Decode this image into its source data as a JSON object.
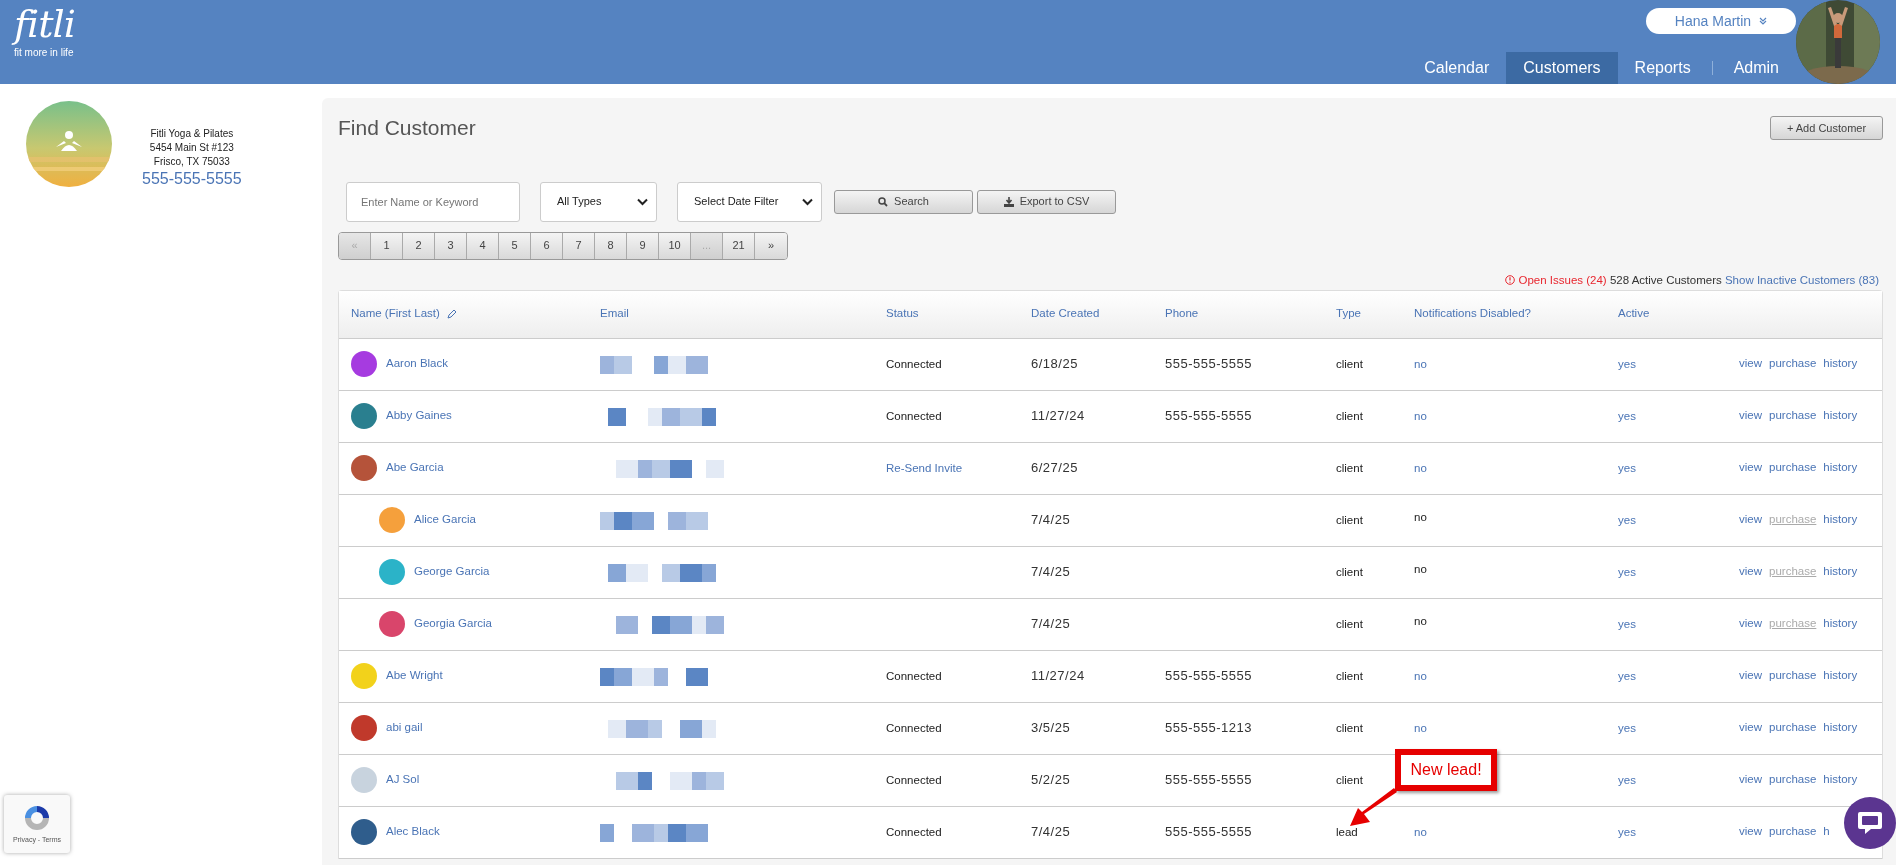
{
  "header": {
    "logo": "fitli",
    "tagline": "fit more in life",
    "user": {
      "name": "Hana Martin"
    },
    "nav": [
      {
        "label": "Calendar",
        "selected": false
      },
      {
        "label": "Customers",
        "selected": true
      },
      {
        "label": "Reports",
        "selected": false
      },
      {
        "label": "Admin",
        "selected": false
      }
    ]
  },
  "business": {
    "name": "Fitli Yoga & Pilates",
    "address": "5454 Main St #123",
    "city": "Frisco, TX 75033",
    "phone": "555-555-5555"
  },
  "page": {
    "title": "Find Customer",
    "add_button": "+ Add Customer"
  },
  "filters": {
    "search": {
      "placeholder": "Enter Name or Keyword"
    },
    "type_select": "All Types",
    "date_select": "Select Date Filter",
    "search_button": "Search",
    "export_button": "Export to CSV"
  },
  "pagination": [
    {
      "label": "«",
      "disabled": true
    },
    {
      "label": "1",
      "disabled": false
    },
    {
      "label": "2",
      "disabled": false
    },
    {
      "label": "3",
      "disabled": false
    },
    {
      "label": "4",
      "disabled": false
    },
    {
      "label": "5",
      "disabled": false
    },
    {
      "label": "6",
      "disabled": false
    },
    {
      "label": "7",
      "disabled": false
    },
    {
      "label": "8",
      "disabled": false
    },
    {
      "label": "9",
      "disabled": false
    },
    {
      "label": "10",
      "disabled": false
    },
    {
      "label": "...",
      "disabled": true
    },
    {
      "label": "21",
      "disabled": false
    },
    {
      "label": "»",
      "disabled": false
    }
  ],
  "summary": {
    "open_issues": "Open Issues (24)",
    "active": "528 Active Customers",
    "inactive_link": "Show Inactive Customers (83)"
  },
  "table": {
    "columns": [
      "Name (First Last)",
      "Email",
      "Status",
      "Date Created",
      "Phone",
      "Type",
      "Notifications Disabled?",
      "Active"
    ],
    "rows": [
      {
        "name": "Aaron Black",
        "color": "#a63be0",
        "status": "Connected",
        "status_link": false,
        "date": "6/18/25",
        "phone": "555-555-5555",
        "type": "client",
        "notifications": "no",
        "notifications_link": true,
        "active": "yes",
        "actions": [
          {
            "label": "view",
            "disabled": false
          },
          {
            "label": "purchase",
            "disabled": false
          },
          {
            "label": "history",
            "disabled": false
          }
        ]
      },
      {
        "name": "Abby Gaines",
        "color": "#2a7f8f",
        "status": "Connected",
        "status_link": false,
        "date": "11/27/24",
        "phone": "555-555-5555",
        "type": "client",
        "notifications": "no",
        "notifications_link": true,
        "active": "yes",
        "actions": [
          {
            "label": "view",
            "disabled": false
          },
          {
            "label": "purchase",
            "disabled": false
          },
          {
            "label": "history",
            "disabled": false
          }
        ]
      },
      {
        "name": "Abe Garcia",
        "color": "#b5533a",
        "status": "Re-Send Invite",
        "status_link": true,
        "date": "6/27/25",
        "type": "client",
        "notifications": "no",
        "notifications_link": true,
        "active": "yes",
        "actions": [
          {
            "label": "view",
            "disabled": false
          },
          {
            "label": "purchase",
            "disabled": false
          },
          {
            "label": "history",
            "disabled": false
          }
        ],
        "children": [
          {
            "name": "Alice Garcia",
            "color": "#f5a03c",
            "date": "7/4/25",
            "type": "client",
            "notifications": "no",
            "notifications_link": false,
            "active": "yes",
            "actions": [
              {
                "label": "view",
                "disabled": false
              },
              {
                "label": "purchase",
                "disabled": true
              },
              {
                "label": "history",
                "disabled": false
              }
            ]
          },
          {
            "name": "George Garcia",
            "color": "#2bb3c8",
            "date": "7/4/25",
            "type": "client",
            "notifications": "no",
            "notifications_link": false,
            "active": "yes",
            "actions": [
              {
                "label": "view",
                "disabled": false
              },
              {
                "label": "purchase",
                "disabled": true
              },
              {
                "label": "history",
                "disabled": false
              }
            ]
          },
          {
            "name": "Georgia Garcia",
            "color": "#d9456b",
            "date": "7/4/25",
            "type": "client",
            "notifications": "no",
            "notifications_link": false,
            "active": "yes",
            "actions": [
              {
                "label": "view",
                "disabled": false
              },
              {
                "label": "purchase",
                "disabled": true
              },
              {
                "label": "history",
                "disabled": false
              }
            ]
          }
        ]
      },
      {
        "name": "Abe Wright",
        "color": "#f2d21b",
        "status": "Connected",
        "status_link": false,
        "date": "11/27/24",
        "phone": "555-555-5555",
        "type": "client",
        "notifications": "no",
        "notifications_link": true,
        "active": "yes",
        "actions": [
          {
            "label": "view",
            "disabled": false
          },
          {
            "label": "purchase",
            "disabled": false
          },
          {
            "label": "history",
            "disabled": false
          }
        ]
      },
      {
        "name": "abi gail",
        "color": "#c0392b",
        "status": "Connected",
        "status_link": false,
        "date": "3/5/25",
        "phone": "555-555-1213",
        "type": "client",
        "notifications": "no",
        "notifications_link": true,
        "active": "yes",
        "actions": [
          {
            "label": "view",
            "disabled": false
          },
          {
            "label": "purchase",
            "disabled": false
          },
          {
            "label": "history",
            "disabled": false
          }
        ]
      },
      {
        "name": "AJ Sol",
        "color": "#c8d3de",
        "status": "Connected",
        "status_link": false,
        "date": "5/2/25",
        "phone": "555-555-5555",
        "type": "client",
        "active": "yes",
        "actions": [
          {
            "label": "view",
            "disabled": false
          },
          {
            "label": "purchase",
            "disabled": false
          },
          {
            "label": "history",
            "disabled": false
          }
        ]
      },
      {
        "name": "Alec Black",
        "color": "#2f5d8c",
        "status": "Connected",
        "status_link": false,
        "date": "7/4/25",
        "phone": "555-555-5555",
        "type": "lead",
        "notifications": "no",
        "notifications_link": true,
        "active": "yes",
        "actions": [
          {
            "label": "view",
            "disabled": false
          },
          {
            "label": "purchase",
            "disabled": false
          },
          {
            "label": "h",
            "disabled": false
          }
        ]
      }
    ]
  },
  "callout": {
    "text": "New lead!"
  },
  "recaptcha": {
    "text": "Privacy - Terms"
  }
}
